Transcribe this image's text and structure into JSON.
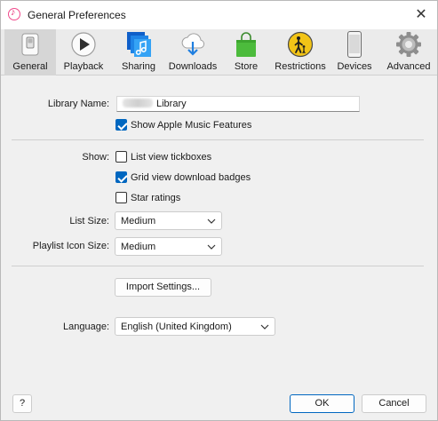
{
  "window": {
    "title": "General Preferences",
    "close_symbol": "✕"
  },
  "toolbar": {
    "tabs": [
      {
        "label": "General",
        "icon": "switch-icon",
        "active": true
      },
      {
        "label": "Playback",
        "icon": "play-icon",
        "active": false
      },
      {
        "label": "Sharing",
        "icon": "music-library-icon",
        "active": false
      },
      {
        "label": "Downloads",
        "icon": "cloud-download-icon",
        "active": false
      },
      {
        "label": "Store",
        "icon": "shopping-bag-icon",
        "active": false
      },
      {
        "label": "Restrictions",
        "icon": "parental-restriction-icon",
        "active": false
      },
      {
        "label": "Devices",
        "icon": "phone-icon",
        "active": false
      },
      {
        "label": "Advanced",
        "icon": "gear-icon",
        "active": false
      }
    ]
  },
  "general": {
    "library_name_label": "Library Name:",
    "library_name_value": "Library",
    "show_apple_music_label": "Show Apple Music Features",
    "show_apple_music_checked": true,
    "show_label": "Show:",
    "list_view_tickboxes_label": "List view tickboxes",
    "list_view_tickboxes_checked": false,
    "grid_view_badges_label": "Grid view download badges",
    "grid_view_badges_checked": true,
    "star_ratings_label": "Star ratings",
    "star_ratings_checked": false,
    "list_size_label": "List Size:",
    "list_size_value": "Medium",
    "playlist_icon_size_label": "Playlist Icon Size:",
    "playlist_icon_size_value": "Medium",
    "import_settings_label": "Import Settings...",
    "language_label": "Language:",
    "language_value": "English (United Kingdom)"
  },
  "footer": {
    "help_label": "?",
    "ok_label": "OK",
    "cancel_label": "Cancel"
  },
  "colors": {
    "accent": "#0067c0",
    "toolbar_bg": "#ebebeb",
    "active_tab_bg": "#d6d6d6"
  }
}
